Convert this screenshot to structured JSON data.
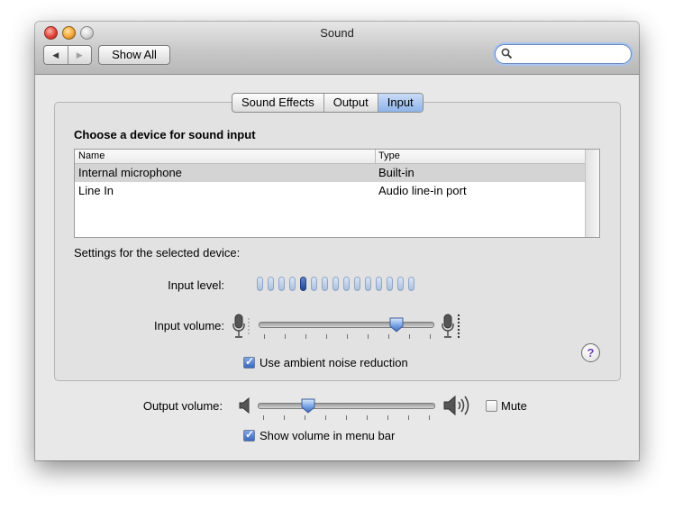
{
  "window": {
    "title": "Sound"
  },
  "toolbar": {
    "show_all_label": "Show All",
    "search": {
      "value": "",
      "placeholder": ""
    }
  },
  "tabs": [
    {
      "label": "Sound Effects",
      "active": false
    },
    {
      "label": "Output",
      "active": false
    },
    {
      "label": "Input",
      "active": true
    }
  ],
  "input_panel": {
    "heading": "Choose a device for sound input",
    "columns": [
      "Name",
      "Type"
    ],
    "devices": [
      {
        "name": "Internal microphone",
        "type": "Built-in",
        "selected": true
      },
      {
        "name": "Line In",
        "type": "Audio line-in port",
        "selected": false
      }
    ],
    "settings_label": "Settings for the selected device:",
    "input_level_label": "Input level:",
    "input_level": {
      "segments": 15,
      "active_segment": 5
    },
    "input_volume_label": "Input volume:",
    "input_volume_value": 0.82,
    "noise_reduction_label": "Use ambient noise reduction",
    "noise_reduction_checked": true
  },
  "output": {
    "output_volume_label": "Output volume:",
    "output_volume_value": 0.27,
    "mute_label": "Mute",
    "mute_checked": false,
    "menu_bar_label": "Show volume in menu bar",
    "menu_bar_checked": true
  },
  "help": {
    "symbol": "?"
  },
  "colors": {
    "selection": "#d4d4d4",
    "accent_blue": "#3b68bd",
    "help_purple": "#6b3fb5"
  },
  "icons": [
    "close-icon",
    "minimize-icon",
    "zoom-icon",
    "back-arrow-icon",
    "forward-arrow-icon",
    "search-icon",
    "microphone-icon",
    "speaker-icon",
    "help-icon"
  ]
}
